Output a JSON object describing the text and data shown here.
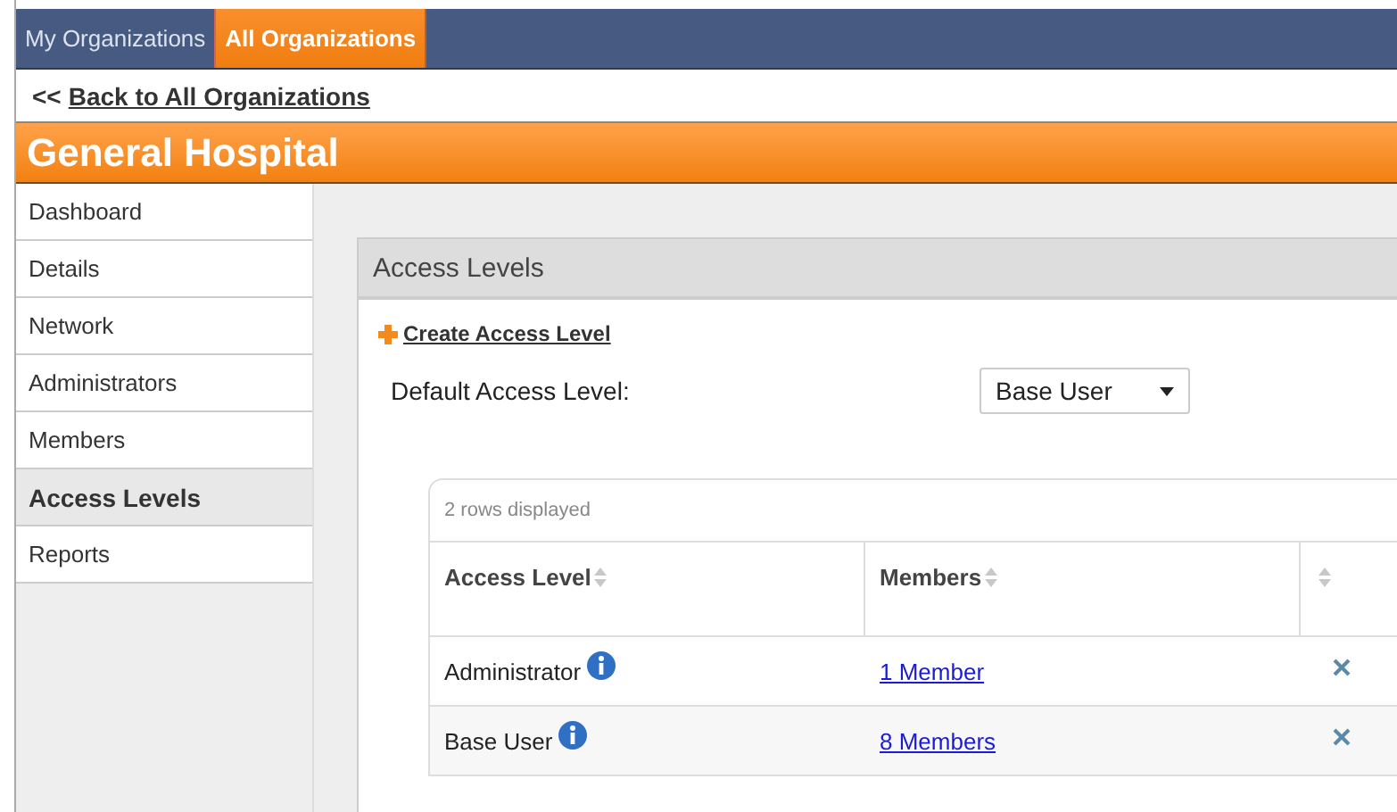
{
  "top_tabs": [
    {
      "label": "My Organizations",
      "selected": false
    },
    {
      "label": "All Organizations",
      "selected": true
    }
  ],
  "back_link": {
    "prefix": "<<",
    "label": "Back to All Organizations"
  },
  "org_title": "General Hospital",
  "sidebar": {
    "items": [
      {
        "label": "Dashboard",
        "selected": false
      },
      {
        "label": "Details",
        "selected": false
      },
      {
        "label": "Network",
        "selected": false
      },
      {
        "label": "Administrators",
        "selected": false
      },
      {
        "label": "Members",
        "selected": false
      },
      {
        "label": "Access Levels",
        "selected": true
      },
      {
        "label": "Reports",
        "selected": false
      }
    ]
  },
  "panel": {
    "title": "Access Levels",
    "create_link": "Create Access Level",
    "default_label": "Default Access Level:",
    "default_value": "Base User"
  },
  "table": {
    "count": "2 rows displayed",
    "columns": [
      "Access Level",
      "Members",
      ""
    ],
    "rows": [
      {
        "name": "Administrator",
        "members": "1 Member"
      },
      {
        "name": "Base User",
        "members": "8 Members"
      }
    ]
  }
}
